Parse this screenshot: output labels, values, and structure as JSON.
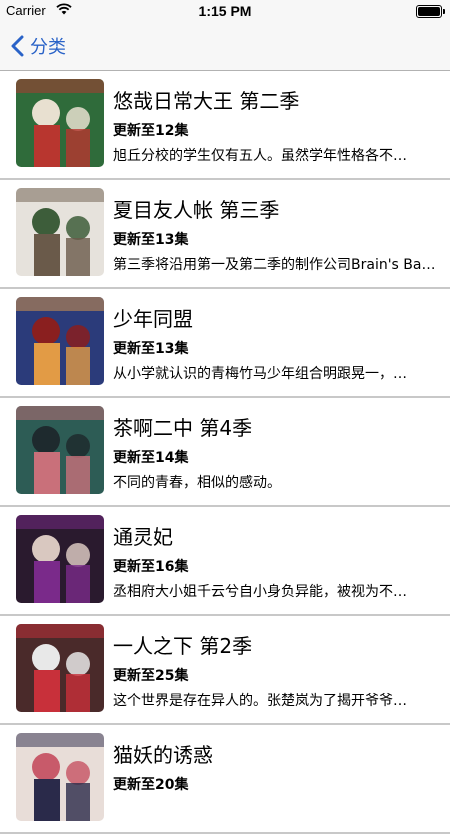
{
  "status_bar": {
    "carrier": "Carrier",
    "time": "1:15 PM"
  },
  "nav": {
    "back_label": "分类",
    "accent": "#2a63c8"
  },
  "items": [
    {
      "title": "悠哉日常大王 第二季",
      "episodes": "更新至12集",
      "description": "旭丘分校的学生仅有五人。虽然学年性格各不…",
      "colors": [
        "#2f6b3a",
        "#b8362f",
        "#e8e0d0"
      ]
    },
    {
      "title": "夏目友人帐 第三季",
      "episodes": "更新至13集",
      "description": "第三季将沿用第一及第二季的制作公司Brain's Base…",
      "colors": [
        "#e6e2dc",
        "#6a5a4a",
        "#3d5d3a"
      ]
    },
    {
      "title": "少年同盟",
      "episodes": "更新至13集",
      "description": "从小学就认识的青梅竹马少年组合明跟晃一，…",
      "colors": [
        "#2b3b7a",
        "#e29b45",
        "#8a1f1f"
      ]
    },
    {
      "title": "茶啊二中 第4季",
      "episodes": "更新至14集",
      "description": "不同的青春，相似的感动。",
      "colors": [
        "#2d5c55",
        "#c9707a",
        "#1e2a2e"
      ]
    },
    {
      "title": "通灵妃",
      "episodes": "更新至16集",
      "description": "丞相府大小姐千云兮自小身负异能，被视为不…",
      "colors": [
        "#2a1a2e",
        "#7a2a8a",
        "#d9c8c0"
      ]
    },
    {
      "title": "一人之下 第2季",
      "episodes": "更新至25集",
      "description": "这个世界是存在异人的。张楚岚为了揭开爷爷…",
      "colors": [
        "#4a2a2a",
        "#c8303a",
        "#e8e8e8"
      ]
    },
    {
      "title": "猫妖的诱惑",
      "episodes": "更新至20集",
      "description": "",
      "colors": [
        "#e8ddd8",
        "#2a2a4a",
        "#c85a6a"
      ]
    }
  ]
}
